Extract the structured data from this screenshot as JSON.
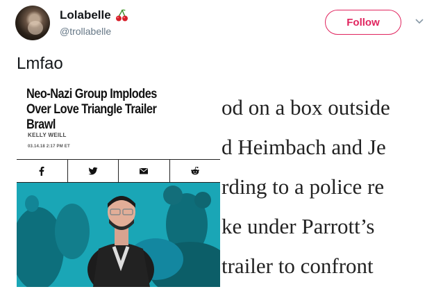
{
  "user": {
    "display_name": "Lolabelle",
    "handle": "@trollabelle",
    "name_emoji": "cherry-icon"
  },
  "follow_button": {
    "label": "Follow"
  },
  "tweet": {
    "text": "Lmfao"
  },
  "article": {
    "headline": "Neo-Nazi Group Implodes Over Love Triangle Trailer Brawl",
    "author": "KELLY WEILL",
    "date": "03.14.18 2:17 PM ET",
    "share_icons": [
      "facebook-icon",
      "twitter-icon",
      "email-icon",
      "reddit-icon"
    ]
  },
  "side_text_lines": [
    "od on a box outside",
    "d Heimbach and Je",
    "rding to a police re",
    "ke under Parrott’s",
    "trailer to confront"
  ],
  "colors": {
    "follow_accent": "#e0245e",
    "photo_teal": "#1ba3b3",
    "handle_gray": "#657786"
  }
}
